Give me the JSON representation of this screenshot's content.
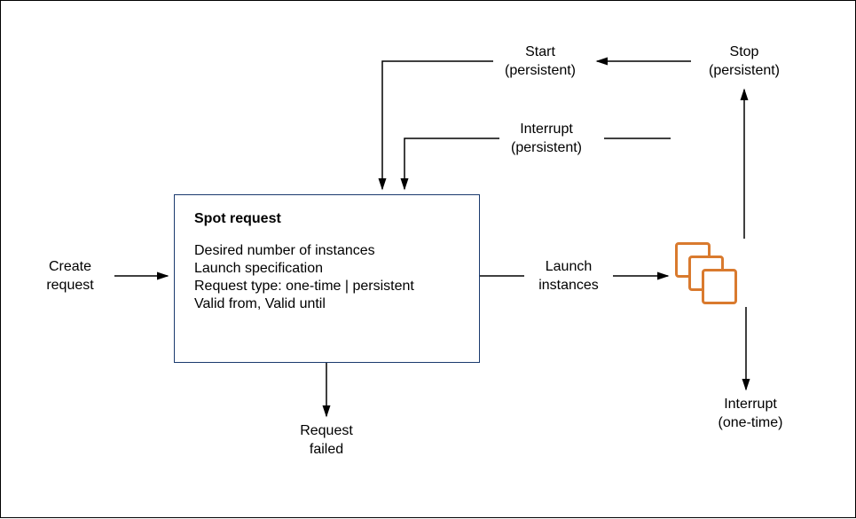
{
  "labels": {
    "create_request": "Create\nrequest",
    "spot_title": "Spot request",
    "spot_lines": {
      "l0": "Desired number of instances",
      "l1": "Launch specification",
      "l2": "Request type: one-time | persistent",
      "l3": "Valid from, Valid until"
    },
    "launch_instances": "Launch\ninstances",
    "request_failed": "Request\nfailed",
    "start_persistent": "Start\n(persistent)",
    "stop_persistent": "Stop\n(persistent)",
    "interrupt_persistent": "Interrupt\n(persistent)",
    "interrupt_onetime": "Interrupt\n(one-time)"
  },
  "colors": {
    "instance_border": "#d97a2e",
    "box_border": "#1a3a6e"
  },
  "semantics": {
    "nodes": [
      "create_request",
      "spot_request",
      "launch_instances",
      "instances",
      "request_failed",
      "start_persistent",
      "stop_persistent",
      "interrupt_persistent",
      "interrupt_onetime"
    ],
    "edges": [
      {
        "from": "create_request",
        "to": "spot_request"
      },
      {
        "from": "spot_request",
        "to": "launch_instances"
      },
      {
        "from": "launch_instances",
        "to": "instances"
      },
      {
        "from": "spot_request",
        "to": "request_failed"
      },
      {
        "from": "instances",
        "to": "stop_persistent"
      },
      {
        "from": "stop_persistent",
        "to": "start_persistent"
      },
      {
        "from": "start_persistent",
        "to": "spot_request"
      },
      {
        "from": "instances",
        "to": "interrupt_persistent",
        "label": "interrupt (persistent)"
      },
      {
        "from": "interrupt_persistent",
        "to": "spot_request"
      },
      {
        "from": "instances",
        "to": "interrupt_onetime"
      }
    ]
  }
}
